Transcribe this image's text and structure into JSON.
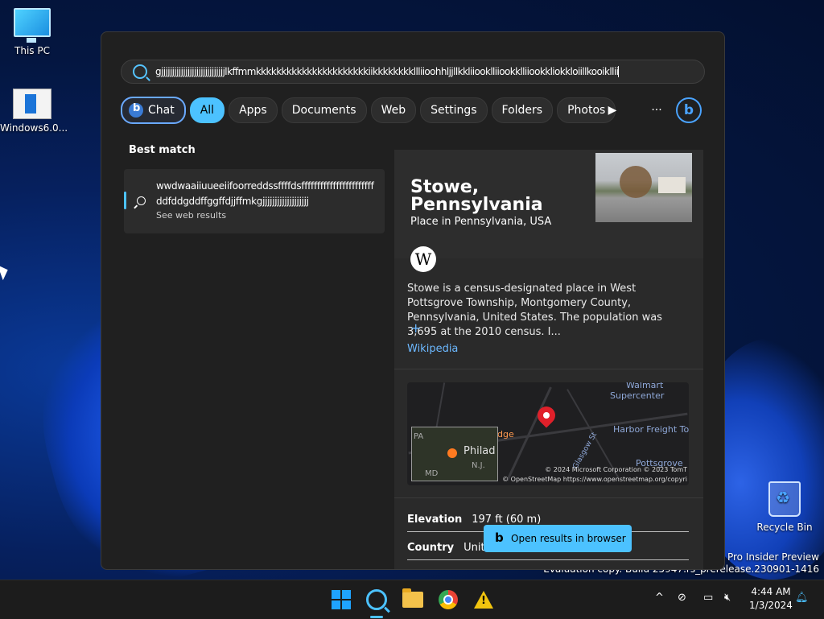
{
  "desktop": {
    "icons": [
      {
        "label": "This PC"
      },
      {
        "label": "Windows6.0..."
      },
      {
        "label": "Recycle Bin"
      }
    ],
    "watermark_line1": "s 11 Pro Insider Preview",
    "watermark_line2": "Evaluation copy. Build 25947.rs_prerelease.230901-1416"
  },
  "search": {
    "query": "gjjjjjjjjjjjjjjjjjjjjjjjjjjjjjlkffmmkkkkkkkkkkkkkkkkkkkkkkiikkkkkkkkllliioohhljjllkkliiooklliiookklliiookkliokkloiillkooikllii",
    "filters": [
      "Chat",
      "All",
      "Apps",
      "Documents",
      "Web",
      "Settings",
      "Folders",
      "Photos"
    ],
    "active_filter": "All",
    "play_icon": "play-icon",
    "more_icon": "more-icon",
    "bing_icon": "bing-icon"
  },
  "best_match": {
    "heading": "Best match",
    "title": "wwdwaaiiuueeiifoorreddssffffdsfffffffffffffffffffffffddfddgddffggffdjjffmkgjjjjjjjjjjjjjjjjjjj",
    "subtitle": "See web results"
  },
  "preview": {
    "title_line1": "Stowe,",
    "title_line2": "Pennsylvania",
    "subtitle": "Place in Pennsylvania, USA",
    "wiki_logo": "W",
    "description": "Stowe is a census-designated place in West Pottsgrove Township, Montgomery County, Pennsylvania, United States. The population was 3,695 at the 2010 census. I...",
    "expand": "+",
    "source_link": "Wikipedia",
    "map": {
      "label_walmart": "Walmart",
      "label_supercenter": "Supercenter",
      "label_harbor": "Harbor Freight To",
      "label_pottsgrove": "Pottsgrove",
      "label_glasgow": "Glasgow St",
      "label_bridge": "dge",
      "inset_city": "Philad",
      "inset_pa": "PA",
      "inset_nj": "N.J.",
      "inset_md": "MD",
      "copyright1": "© 2024 Microsoft Corporation © 2023 TomT",
      "copyright2": "© OpenStreetMap https://www.openstreetmap.org/copyri"
    },
    "facts": [
      {
        "label": "Elevation",
        "value": "197 ft (60 m)"
      },
      {
        "label": "Country",
        "value": "Unite"
      }
    ]
  },
  "open_browser_label": "Open results in browser",
  "taskbar": {
    "time": "4:44 AM",
    "date": "1/3/2024",
    "tray_chevron": "^"
  }
}
